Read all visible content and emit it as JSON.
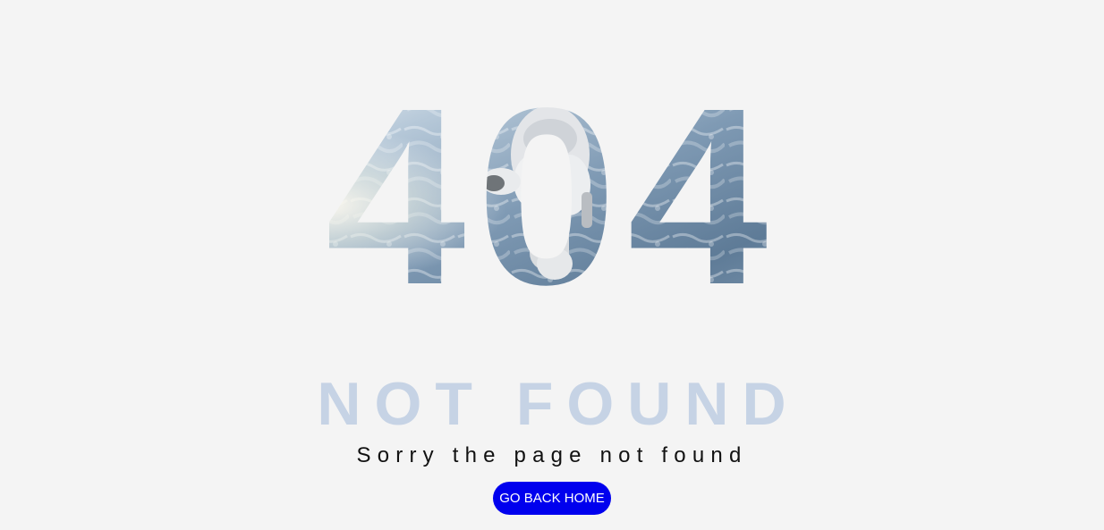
{
  "error": {
    "code": "404",
    "headline": "NOT FOUND",
    "message": "Sorry the page not found"
  },
  "actions": {
    "home_label": "GO BACK HOME"
  },
  "colors": {
    "background": "#f4f4f4",
    "headline": "#c6d3e5",
    "button": "#0000ee",
    "button_text": "#ffffff"
  }
}
